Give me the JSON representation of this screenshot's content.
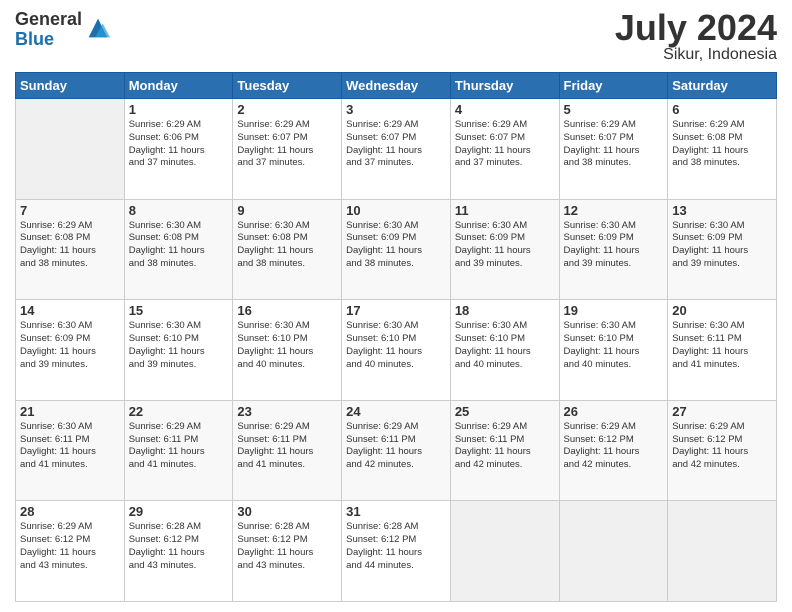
{
  "header": {
    "logo_general": "General",
    "logo_blue": "Blue",
    "month_year": "July 2024",
    "location": "Sikur, Indonesia"
  },
  "days_of_week": [
    "Sunday",
    "Monday",
    "Tuesday",
    "Wednesday",
    "Thursday",
    "Friday",
    "Saturday"
  ],
  "weeks": [
    [
      {
        "day": "",
        "info": ""
      },
      {
        "day": "1",
        "info": "Sunrise: 6:29 AM\nSunset: 6:06 PM\nDaylight: 11 hours\nand 37 minutes."
      },
      {
        "day": "2",
        "info": "Sunrise: 6:29 AM\nSunset: 6:07 PM\nDaylight: 11 hours\nand 37 minutes."
      },
      {
        "day": "3",
        "info": "Sunrise: 6:29 AM\nSunset: 6:07 PM\nDaylight: 11 hours\nand 37 minutes."
      },
      {
        "day": "4",
        "info": "Sunrise: 6:29 AM\nSunset: 6:07 PM\nDaylight: 11 hours\nand 37 minutes."
      },
      {
        "day": "5",
        "info": "Sunrise: 6:29 AM\nSunset: 6:07 PM\nDaylight: 11 hours\nand 38 minutes."
      },
      {
        "day": "6",
        "info": "Sunrise: 6:29 AM\nSunset: 6:08 PM\nDaylight: 11 hours\nand 38 minutes."
      }
    ],
    [
      {
        "day": "7",
        "info": "Sunrise: 6:29 AM\nSunset: 6:08 PM\nDaylight: 11 hours\nand 38 minutes."
      },
      {
        "day": "8",
        "info": "Sunrise: 6:30 AM\nSunset: 6:08 PM\nDaylight: 11 hours\nand 38 minutes."
      },
      {
        "day": "9",
        "info": "Sunrise: 6:30 AM\nSunset: 6:08 PM\nDaylight: 11 hours\nand 38 minutes."
      },
      {
        "day": "10",
        "info": "Sunrise: 6:30 AM\nSunset: 6:09 PM\nDaylight: 11 hours\nand 38 minutes."
      },
      {
        "day": "11",
        "info": "Sunrise: 6:30 AM\nSunset: 6:09 PM\nDaylight: 11 hours\nand 39 minutes."
      },
      {
        "day": "12",
        "info": "Sunrise: 6:30 AM\nSunset: 6:09 PM\nDaylight: 11 hours\nand 39 minutes."
      },
      {
        "day": "13",
        "info": "Sunrise: 6:30 AM\nSunset: 6:09 PM\nDaylight: 11 hours\nand 39 minutes."
      }
    ],
    [
      {
        "day": "14",
        "info": "Sunrise: 6:30 AM\nSunset: 6:09 PM\nDaylight: 11 hours\nand 39 minutes."
      },
      {
        "day": "15",
        "info": "Sunrise: 6:30 AM\nSunset: 6:10 PM\nDaylight: 11 hours\nand 39 minutes."
      },
      {
        "day": "16",
        "info": "Sunrise: 6:30 AM\nSunset: 6:10 PM\nDaylight: 11 hours\nand 40 minutes."
      },
      {
        "day": "17",
        "info": "Sunrise: 6:30 AM\nSunset: 6:10 PM\nDaylight: 11 hours\nand 40 minutes."
      },
      {
        "day": "18",
        "info": "Sunrise: 6:30 AM\nSunset: 6:10 PM\nDaylight: 11 hours\nand 40 minutes."
      },
      {
        "day": "19",
        "info": "Sunrise: 6:30 AM\nSunset: 6:10 PM\nDaylight: 11 hours\nand 40 minutes."
      },
      {
        "day": "20",
        "info": "Sunrise: 6:30 AM\nSunset: 6:11 PM\nDaylight: 11 hours\nand 41 minutes."
      }
    ],
    [
      {
        "day": "21",
        "info": "Sunrise: 6:30 AM\nSunset: 6:11 PM\nDaylight: 11 hours\nand 41 minutes."
      },
      {
        "day": "22",
        "info": "Sunrise: 6:29 AM\nSunset: 6:11 PM\nDaylight: 11 hours\nand 41 minutes."
      },
      {
        "day": "23",
        "info": "Sunrise: 6:29 AM\nSunset: 6:11 PM\nDaylight: 11 hours\nand 41 minutes."
      },
      {
        "day": "24",
        "info": "Sunrise: 6:29 AM\nSunset: 6:11 PM\nDaylight: 11 hours\nand 42 minutes."
      },
      {
        "day": "25",
        "info": "Sunrise: 6:29 AM\nSunset: 6:11 PM\nDaylight: 11 hours\nand 42 minutes."
      },
      {
        "day": "26",
        "info": "Sunrise: 6:29 AM\nSunset: 6:12 PM\nDaylight: 11 hours\nand 42 minutes."
      },
      {
        "day": "27",
        "info": "Sunrise: 6:29 AM\nSunset: 6:12 PM\nDaylight: 11 hours\nand 42 minutes."
      }
    ],
    [
      {
        "day": "28",
        "info": "Sunrise: 6:29 AM\nSunset: 6:12 PM\nDaylight: 11 hours\nand 43 minutes."
      },
      {
        "day": "29",
        "info": "Sunrise: 6:28 AM\nSunset: 6:12 PM\nDaylight: 11 hours\nand 43 minutes."
      },
      {
        "day": "30",
        "info": "Sunrise: 6:28 AM\nSunset: 6:12 PM\nDaylight: 11 hours\nand 43 minutes."
      },
      {
        "day": "31",
        "info": "Sunrise: 6:28 AM\nSunset: 6:12 PM\nDaylight: 11 hours\nand 44 minutes."
      },
      {
        "day": "",
        "info": ""
      },
      {
        "day": "",
        "info": ""
      },
      {
        "day": "",
        "info": ""
      }
    ]
  ]
}
